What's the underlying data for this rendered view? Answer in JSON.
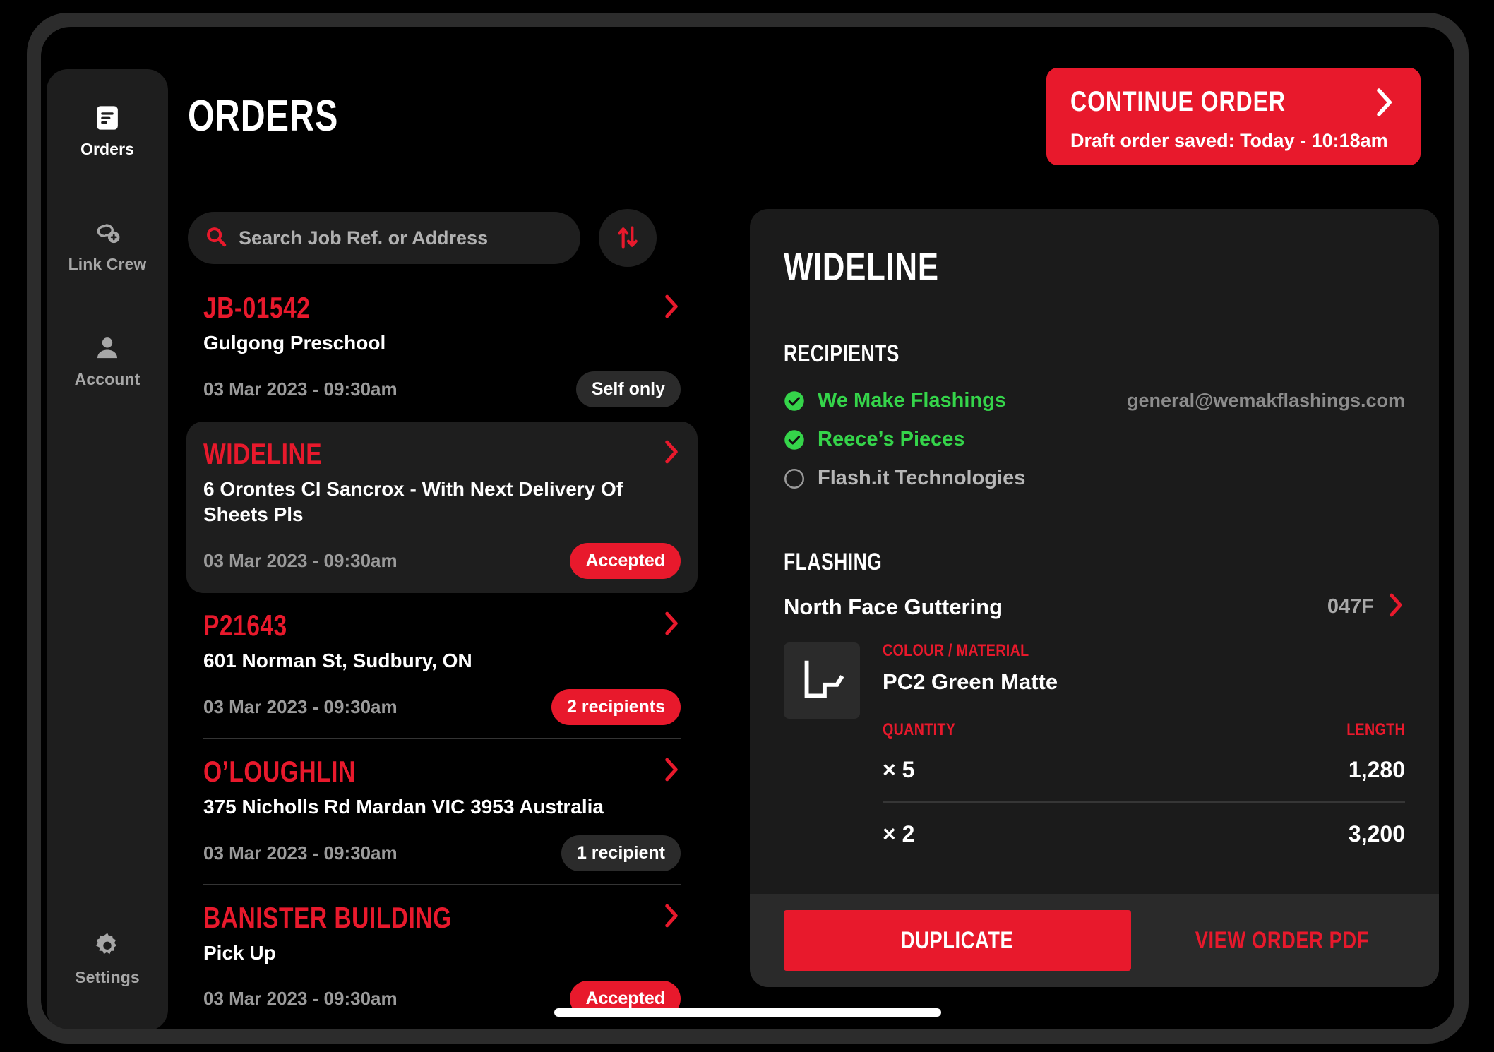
{
  "colors": {
    "accent_red": "#E8192C",
    "accent_green": "#35D44A",
    "screen_bg": "#000000",
    "panel_bg": "#1b1b1b",
    "sidebar_bg": "#1e1e1e"
  },
  "sidebar": {
    "items": [
      {
        "label": "Orders",
        "icon": "document-icon",
        "active": true
      },
      {
        "label": "Link Crew",
        "icon": "link-add-icon",
        "active": false
      },
      {
        "label": "Account",
        "icon": "person-icon",
        "active": false
      }
    ],
    "settings": {
      "label": "Settings",
      "icon": "gear-icon"
    }
  },
  "header": {
    "title": "ORDERS",
    "continue_order": {
      "label": "CONTINUE ORDER",
      "sublabel": "Draft order saved: Today - 10:18am",
      "chevron_icon": "chevron-right-icon"
    }
  },
  "search": {
    "placeholder": "Search Job Ref. or Address",
    "value": "",
    "icon": "search-icon",
    "sort_icon": "sort-updown-icon"
  },
  "orders": [
    {
      "ref": "JB-01542",
      "address": "Gulgong Preschool",
      "date": "03 Mar 2023 - 09:30am",
      "badge": "Self only",
      "badge_style": "grey",
      "selected": false
    },
    {
      "ref": "WIDELINE",
      "address": "6 Orontes Cl Sancrox - With Next Delivery Of Sheets Pls",
      "date": "03 Mar 2023 - 09:30am",
      "badge": "Accepted",
      "badge_style": "red",
      "selected": true
    },
    {
      "ref": "P21643",
      "address": "601 Norman St, Sudbury, ON",
      "date": "03 Mar 2023 - 09:30am",
      "badge": "2 recipients",
      "badge_style": "red",
      "selected": false
    },
    {
      "ref": "O’LOUGHLIN",
      "address": "375 Nicholls Rd Mardan VIC 3953 Australia",
      "date": "03 Mar 2023 - 09:30am",
      "badge": "1 recipient",
      "badge_style": "grey",
      "selected": false
    },
    {
      "ref": "BANISTER BUILDING",
      "address": "Pick Up",
      "date": "03 Mar 2023 - 09:30am",
      "badge": "Accepted",
      "badge_style": "red",
      "selected": false
    }
  ],
  "detail": {
    "title": "WIDELINE",
    "recipients_heading": "RECIPIENTS",
    "recipients": [
      {
        "name": "We Make Flashings",
        "email": "general@wemakflashings.com",
        "checked": true
      },
      {
        "name": "Reece’s Pieces",
        "email": "",
        "checked": true
      },
      {
        "name": "Flash.it Technologies",
        "email": "",
        "checked": false
      }
    ],
    "flashing_heading": "FLASHING",
    "flashing": {
      "name": "North Face Guttering",
      "code": "047F",
      "chevron_icon": "chevron-right-icon",
      "thumb_icon": "flashing-profile-icon",
      "colour_label": "COLOUR / MATERIAL",
      "colour_value": "PC2 Green Matte",
      "quantity_label": "QUANTITY",
      "length_label": "LENGTH",
      "rows": [
        {
          "quantity": "× 5",
          "length": "1,280"
        },
        {
          "quantity": "× 2",
          "length": "3,200"
        }
      ]
    },
    "actions": {
      "duplicate": "DUPLICATE",
      "view_pdf": "VIEW ORDER PDF"
    }
  }
}
